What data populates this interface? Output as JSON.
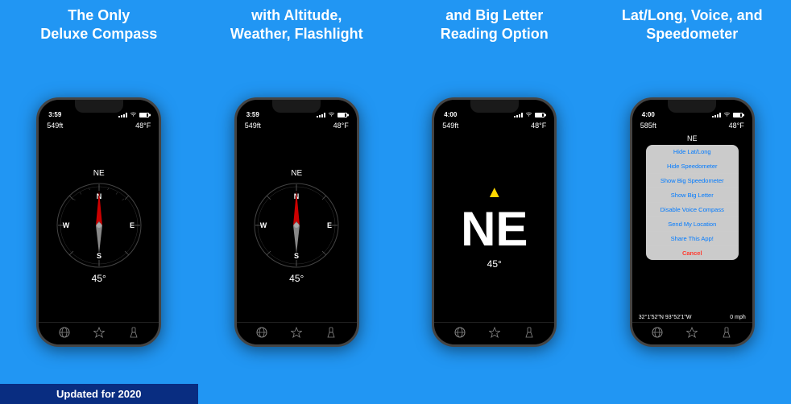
{
  "panels": [
    {
      "id": "panel1",
      "header": "The Only\nDeluxe Compass",
      "footer": "Updated for 2020",
      "phone": {
        "time": "3:59",
        "altitude": "549ft",
        "temperature": "48°F",
        "direction": "NE",
        "degrees": "45°",
        "screen_type": "compass"
      }
    },
    {
      "id": "panel2",
      "header": "with Altitude,\nWeather, Flashlight",
      "footer": null,
      "phone": {
        "time": "3:59",
        "altitude": "549ft",
        "temperature": "48°F",
        "direction": "NE",
        "degrees": "45°",
        "screen_type": "compass"
      }
    },
    {
      "id": "panel3",
      "header": "and Big Letter\nReading Option",
      "footer": null,
      "phone": {
        "time": "4:00",
        "altitude": "549ft",
        "temperature": "48°F",
        "big_letter": "NE",
        "degrees": "45°",
        "screen_type": "big_letter"
      }
    },
    {
      "id": "panel4",
      "header": "Lat/Long, Voice, and\nSpeedometer",
      "footer": null,
      "phone": {
        "time": "4:00",
        "altitude": "585ft",
        "temperature": "48°F",
        "direction": "NE",
        "gps": "32°1'52\"N 93°52'1\"W",
        "speed": "0 mph",
        "screen_type": "menu",
        "menu_items": [
          {
            "label": "Hide Lat/Long",
            "type": "blue"
          },
          {
            "label": "Hide Speedometer",
            "type": "blue"
          },
          {
            "label": "Show Big Speedometer",
            "type": "blue"
          },
          {
            "label": "Show Big Letter",
            "type": "blue"
          },
          {
            "label": "Disable Voice Compass",
            "type": "blue"
          },
          {
            "label": "Send My Location",
            "type": "blue"
          },
          {
            "label": "Share This App!",
            "type": "blue"
          },
          {
            "label": "Cancel",
            "type": "red"
          }
        ]
      }
    }
  ],
  "bottom_icons": {
    "globe": "🌐",
    "star": "⭐",
    "flashlight": "🔦"
  }
}
